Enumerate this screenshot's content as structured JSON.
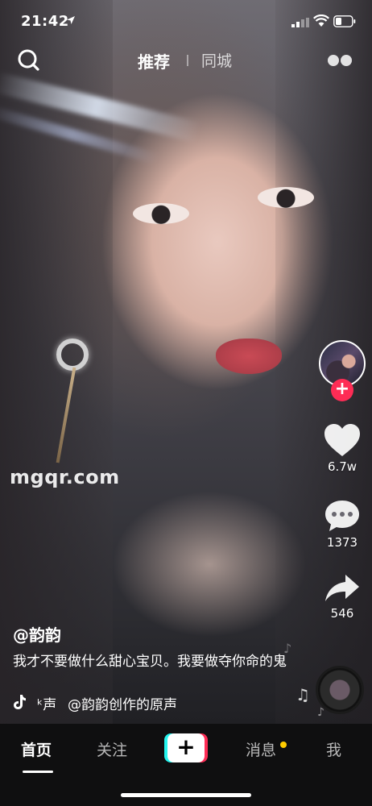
{
  "status_bar": {
    "time": "21:42",
    "icons": [
      "location-arrow-icon",
      "cellular-signal-icon",
      "wifi-icon",
      "battery-icon"
    ]
  },
  "top_nav": {
    "tabs": [
      {
        "label": "推荐",
        "active": true
      },
      {
        "label": "同城",
        "active": false
      }
    ],
    "icons": [
      "search-icon",
      "more-icon"
    ]
  },
  "watermark": "mgqr.com",
  "right_rail": {
    "follow_icon": "+",
    "like_count": "6.7w",
    "comment_count": "1373",
    "share_count": "546"
  },
  "caption": {
    "username": "@韵韵",
    "description": "我才不要做什么甜心宝贝。我要做夺你命的鬼",
    "music_prefix": "ᵏ声",
    "music_title": "@韵韵创作的原声"
  },
  "bottom_nav": {
    "items": [
      {
        "label": "首页",
        "active": true
      },
      {
        "label": "关注",
        "active": false
      },
      {
        "label": "+",
        "active": false
      },
      {
        "label": "消息",
        "active": false
      },
      {
        "label": "我",
        "active": false
      }
    ]
  },
  "colors": {
    "accent_red": "#fe2c55",
    "accent_cyan": "#25f4ee",
    "notification_dot": "#ffcc00",
    "nav_background": "#0f0f10"
  }
}
